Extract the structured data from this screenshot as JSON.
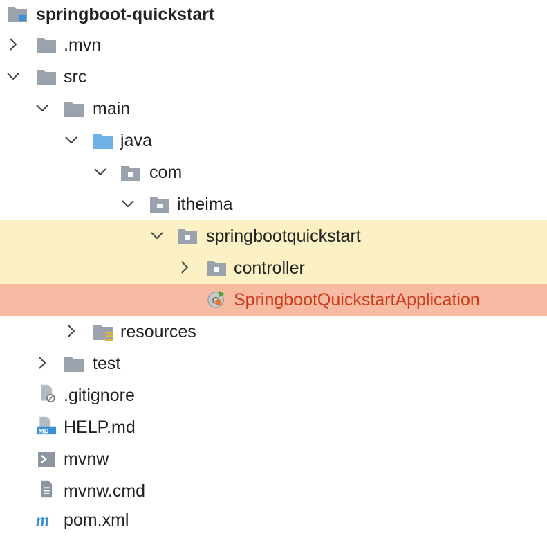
{
  "tree": {
    "root": {
      "label": "springboot-quickstart",
      "icon": "project-folder-icon"
    },
    "items": [
      {
        "label": ".mvn",
        "icon": "folder-icon",
        "expanded": false
      },
      {
        "label": "src",
        "icon": "folder-icon",
        "expanded": true
      },
      {
        "label": "main",
        "icon": "folder-icon",
        "expanded": true
      },
      {
        "label": "java",
        "icon": "source-folder-icon",
        "expanded": true
      },
      {
        "label": "com",
        "icon": "package-icon",
        "expanded": true
      },
      {
        "label": "itheima",
        "icon": "package-icon",
        "expanded": true
      },
      {
        "label": "springbootquickstart",
        "icon": "package-icon",
        "expanded": true
      },
      {
        "label": "controller",
        "icon": "package-icon",
        "expanded": false
      },
      {
        "label": "SpringbootQuickstartApplication",
        "icon": "spring-boot-class-icon"
      },
      {
        "label": "resources",
        "icon": "resources-folder-icon",
        "expanded": false
      },
      {
        "label": "test",
        "icon": "folder-icon",
        "expanded": false
      },
      {
        "label": ".gitignore",
        "icon": "gitignore-file-icon"
      },
      {
        "label": "HELP.md",
        "icon": "markdown-file-icon"
      },
      {
        "label": "mvnw",
        "icon": "shell-script-icon"
      },
      {
        "label": "mvnw.cmd",
        "icon": "text-file-icon"
      },
      {
        "label": "pom.xml",
        "icon": "maven-pom-icon"
      }
    ]
  },
  "colors": {
    "package_highlight": "#fbf1c4",
    "selected_highlight": "#f6bba2",
    "selected_text": "#cc3a18",
    "folder_gray": "#9aa3ad",
    "source_folder_blue": "#6fb3e6"
  }
}
